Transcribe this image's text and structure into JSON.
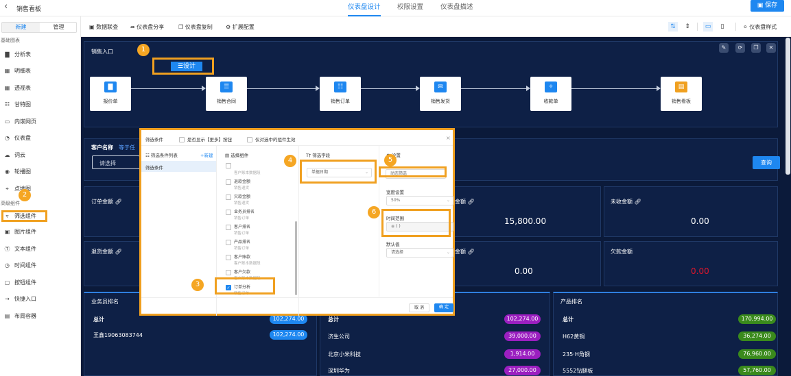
{
  "header": {
    "back_icon": "chevron-left-icon",
    "title": "销售看板",
    "tabs": [
      {
        "label": "仪表盘设计",
        "active": true
      },
      {
        "label": "权限设置",
        "active": false
      },
      {
        "label": "仪表盘描述",
        "active": false
      }
    ],
    "save_label": "保存"
  },
  "sidebar": {
    "tabs": [
      "新建",
      "管理"
    ],
    "basic_group_label": "基础图表",
    "basic_items": [
      {
        "label": "分析表",
        "icon": "bar-chart-icon"
      },
      {
        "label": "明细表",
        "icon": "table-icon"
      },
      {
        "label": "透视表",
        "icon": "grid-icon"
      },
      {
        "label": "甘特图",
        "icon": "gantt-icon"
      },
      {
        "label": "内嵌网页",
        "icon": "webpage-icon"
      },
      {
        "label": "仪表盘",
        "icon": "gauge-icon"
      },
      {
        "label": "词云",
        "icon": "cloud-icon"
      },
      {
        "label": "轮播图",
        "icon": "carousel-icon"
      },
      {
        "label": "点地图",
        "icon": "map-pin-icon"
      }
    ],
    "advanced_group_label": "高级组件",
    "advanced_items": [
      {
        "label": "筛选组件",
        "icon": "filter-icon",
        "highlighted": true
      },
      {
        "label": "图片组件",
        "icon": "image-icon"
      },
      {
        "label": "文本组件",
        "icon": "text-icon"
      },
      {
        "label": "时间组件",
        "icon": "clock-icon"
      },
      {
        "label": "按钮组件",
        "icon": "button-icon"
      },
      {
        "label": "快捷入口",
        "icon": "shortcut-icon"
      },
      {
        "label": "布局容器",
        "icon": "layout-icon"
      }
    ]
  },
  "toolbar": {
    "items": [
      "数据联查",
      "仪表盘分享",
      "仪表盘复制",
      "扩展配置"
    ],
    "style_label": "仪表盘样式"
  },
  "flow": {
    "title": "销售入口",
    "design_label": "设计",
    "nodes": [
      "报价单",
      "销售合同",
      "销售订单",
      "销售发货",
      "收款单",
      "销售看板"
    ],
    "node_colors": [
      "#1e87f0",
      "#1e87f0",
      "#1e87f0",
      "#1e87f0",
      "#1e87f0",
      "#f0a020"
    ]
  },
  "filter_bar": {
    "label": "客户名称",
    "extra": "等于任",
    "placeholder": "请选择",
    "query_label": "查询"
  },
  "kpis": [
    {
      "title": "订单金额",
      "value": ""
    },
    {
      "title": "金额",
      "value": "15,800.00"
    },
    {
      "title": "未收金额",
      "value": "0.00"
    },
    {
      "title": "退货金额",
      "value": ""
    },
    {
      "title": "金额",
      "value": "0.00"
    },
    {
      "title": "欠款金额",
      "value": "0.00"
    }
  ],
  "rank_salesman": {
    "title": "业务员排名",
    "rows": [
      {
        "name": "总计",
        "value": "102,274.00"
      },
      {
        "name": "王鑫19063083744",
        "value": "102,274.00"
      }
    ]
  },
  "rank_customer": {
    "rows": [
      {
        "name": "总计",
        "value": "102,274.00"
      },
      {
        "name": "济生公司",
        "value": "39,000.00"
      },
      {
        "name": "北京小米科技",
        "value": "1,914.00"
      },
      {
        "name": "深圳华为",
        "value": "27,000.00"
      }
    ]
  },
  "rank_product": {
    "title": "产品排名",
    "rows": [
      {
        "name": "总计",
        "value": "170,994.00"
      },
      {
        "name": "H62黄铜",
        "value": "36,274.00"
      },
      {
        "name": "235·H角钢",
        "value": "76,960.00"
      },
      {
        "name": "5552钻腿板",
        "value": "57,760.00"
      }
    ]
  },
  "dialog": {
    "title": "筛选条件",
    "check1": "是否显示【更多】按钮",
    "check2": "仅对选中的组件生效",
    "left_title": "筛选条件列表",
    "new_label": "+新建",
    "left_item": "筛选条件",
    "mid_title": "选择组件",
    "fields": [
      {
        "name": "",
        "sub": "客户账本数据段"
      },
      {
        "name": "退款金额",
        "sub": "销售退货"
      },
      {
        "name": "欠款金额",
        "sub": "销售退货"
      },
      {
        "name": "业务员排名",
        "sub": "销售订单"
      },
      {
        "name": "客户排名",
        "sub": "销售订单"
      },
      {
        "name": "产品排名",
        "sub": "销售订单"
      },
      {
        "name": "客户账款",
        "sub": "客户账本数据段"
      },
      {
        "name": "客户欠款",
        "sub": "客户账本数据段"
      },
      {
        "name": "订单分析",
        "sub": "销售订单",
        "checked": true
      }
    ],
    "field_title": "筛选字段",
    "field_value": "单据日期",
    "settings_title": "设置",
    "dyn_label": "动态筛选",
    "width_label": "宽度设置",
    "width_value": "50%",
    "range_label": "时间范围",
    "range_value": "( )",
    "default_label": "默认值",
    "default_placeholder": "请选择",
    "cancel_label": "取 消",
    "ok_label": "确 定"
  },
  "markers": [
    "1",
    "2",
    "3",
    "4",
    "5",
    "6"
  ]
}
